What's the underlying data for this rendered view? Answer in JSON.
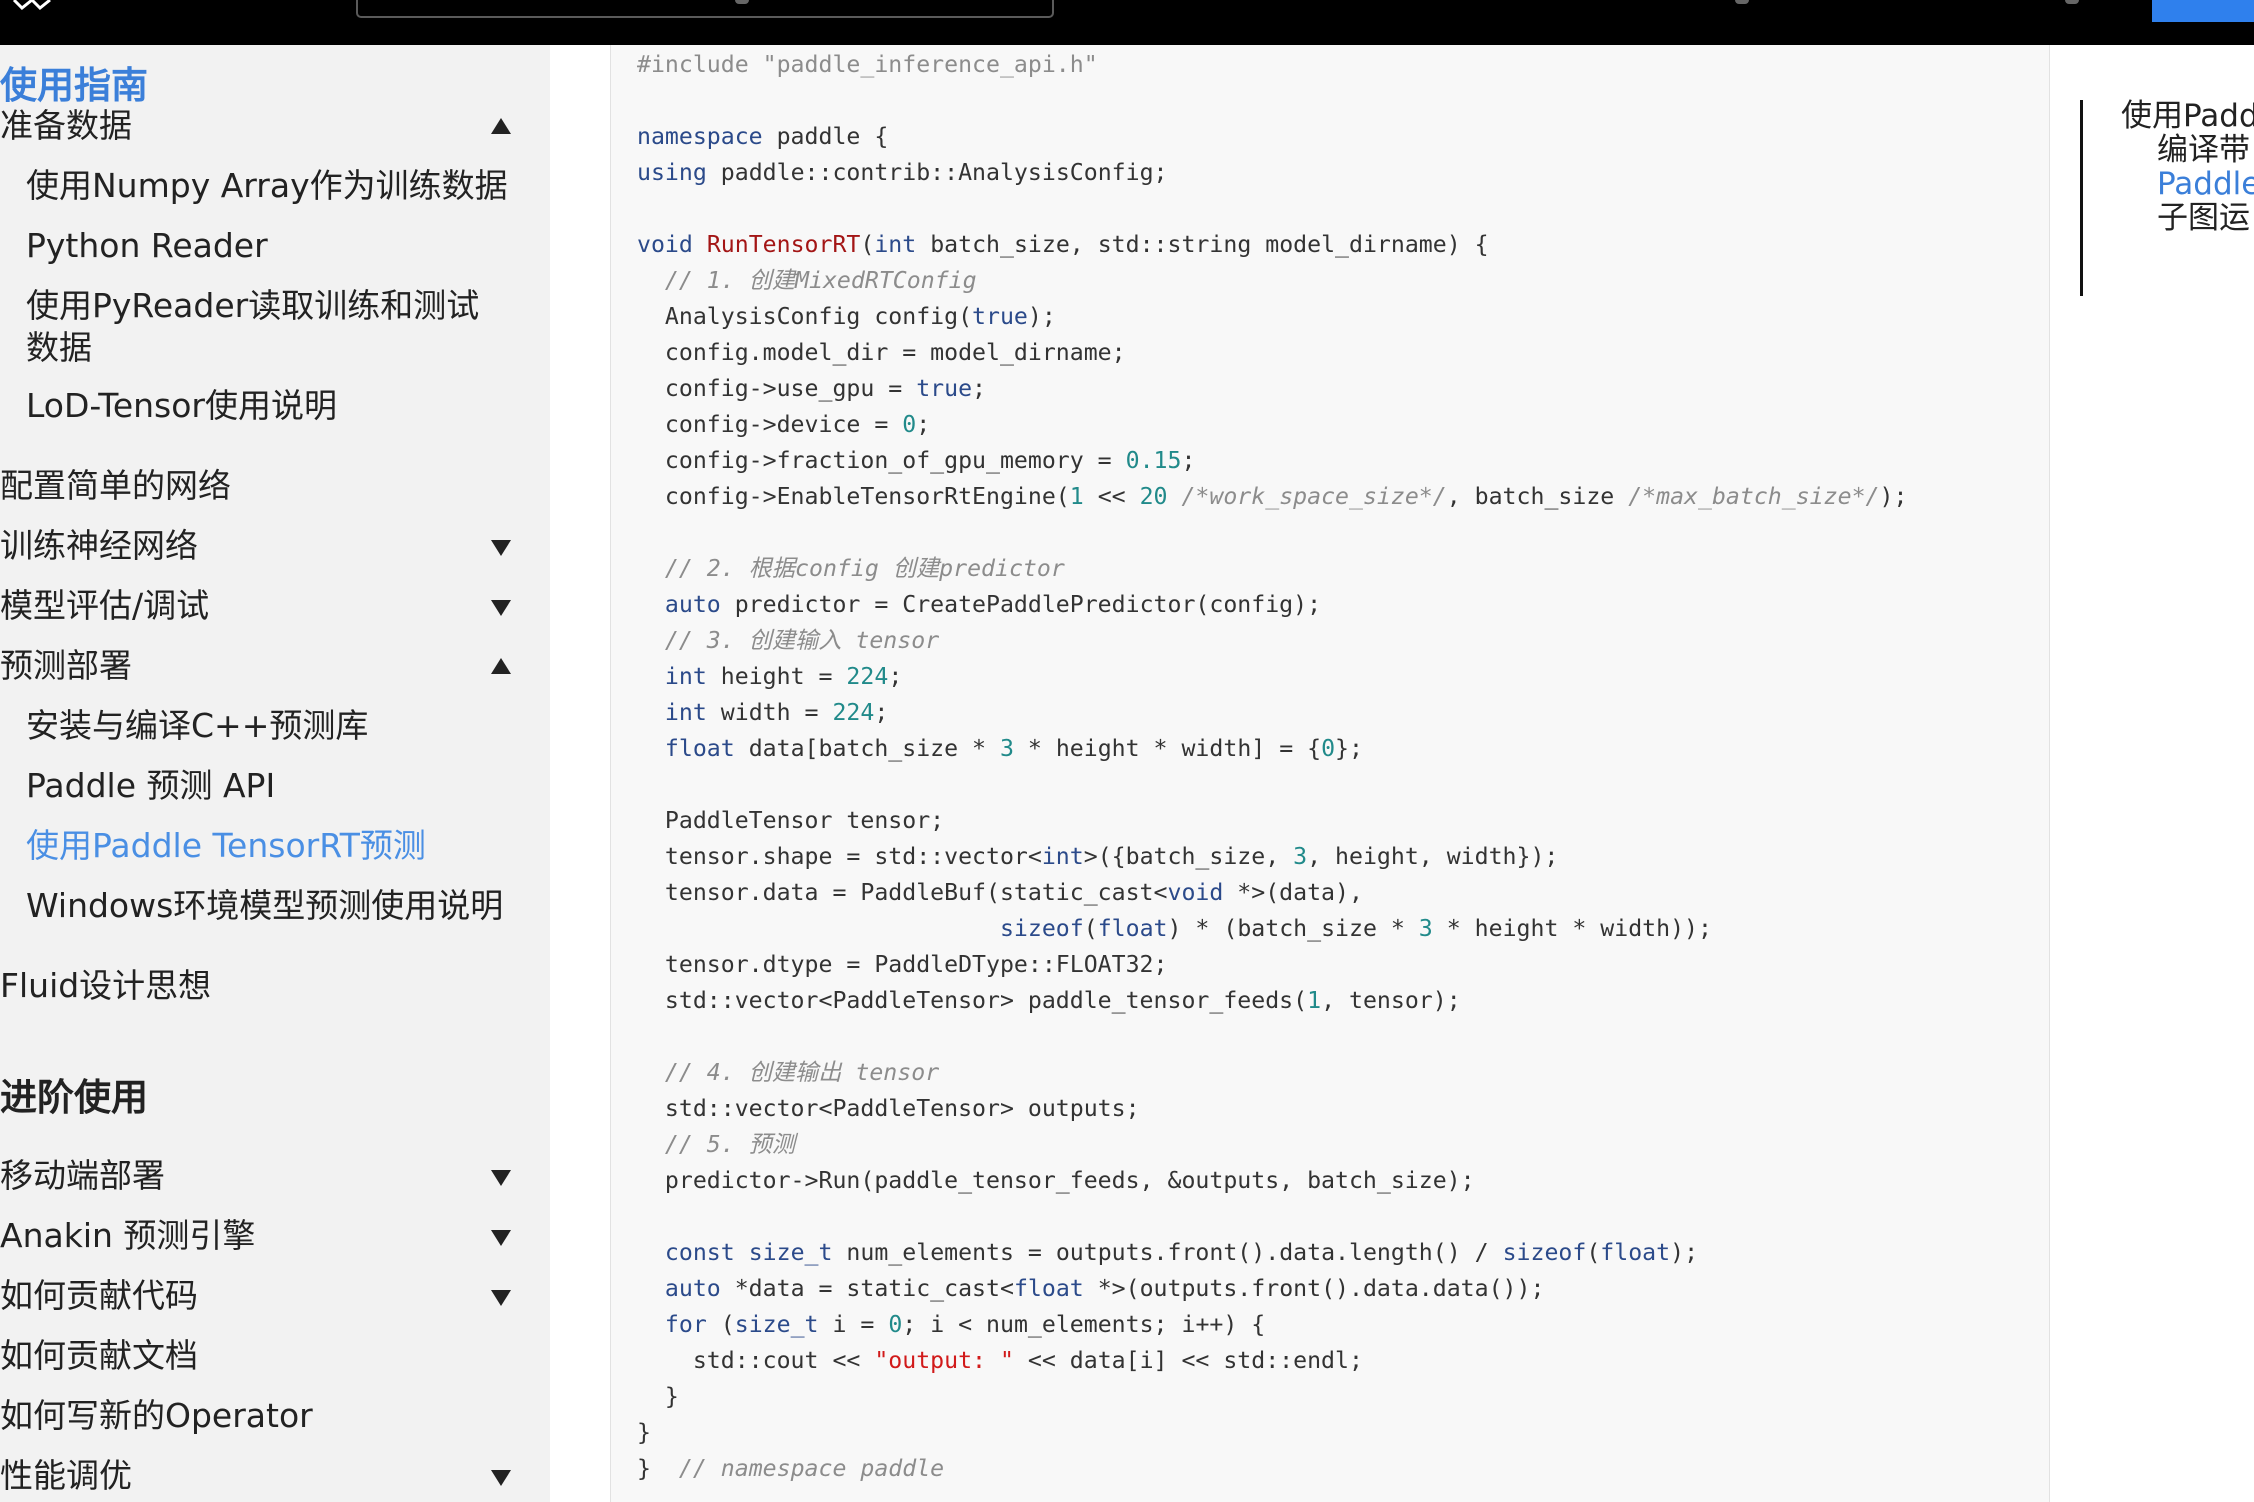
{
  "topbar": {
    "back_icon": "double-chevron-left-icon"
  },
  "sidebar": {
    "items": [
      {
        "label": "使用指南",
        "kind": "section",
        "caret": null
      },
      {
        "label": "准备数据",
        "kind": "top",
        "caret": "up"
      },
      {
        "label": "使用Numpy Array作为训练数据",
        "kind": "sub",
        "caret": null
      },
      {
        "label": "Python Reader",
        "kind": "sub",
        "caret": null
      },
      {
        "label": "使用PyReader读取训练和测试数据",
        "kind": "sub-wrap",
        "caret": null
      },
      {
        "label": "LoD-Tensor使用说明",
        "kind": "sub",
        "caret": null
      },
      {
        "label": "配置简单的网络",
        "kind": "top",
        "caret": null
      },
      {
        "label": "训练神经网络",
        "kind": "top",
        "caret": "down"
      },
      {
        "label": "模型评估/调试",
        "kind": "top",
        "caret": "down"
      },
      {
        "label": "预测部署",
        "kind": "top",
        "caret": "up"
      },
      {
        "label": "安装与编译C++预测库",
        "kind": "sub",
        "caret": null
      },
      {
        "label": "Paddle 预测 API",
        "kind": "sub",
        "caret": null
      },
      {
        "label": "使用Paddle TensorRT预测",
        "kind": "sub-active",
        "caret": null
      },
      {
        "label": "Windows环境模型预测使用说明",
        "kind": "sub",
        "caret": null
      },
      {
        "label": "Fluid设计思想",
        "kind": "top",
        "caret": null
      },
      {
        "label": "进阶使用",
        "kind": "section-dark",
        "caret": null
      },
      {
        "label": "移动端部署",
        "kind": "top",
        "caret": "down"
      },
      {
        "label": "Anakin 预测引擎",
        "kind": "top",
        "caret": "down"
      },
      {
        "label": "如何贡献代码",
        "kind": "top",
        "caret": "down"
      },
      {
        "label": "如何贡献文档",
        "kind": "top",
        "caret": null
      },
      {
        "label": "如何写新的Operator",
        "kind": "top",
        "caret": null
      },
      {
        "label": "性能调优",
        "kind": "top",
        "caret": "down"
      }
    ]
  },
  "code": {
    "lines": [
      "#include \"paddle_inference_api.h\"",
      "",
      "namespace paddle {",
      "using paddle::contrib::AnalysisConfig;",
      "",
      "void RunTensorRT(int batch_size, std::string model_dirname) {",
      "  // 1. 创建MixedRTConfig",
      "  AnalysisConfig config(true);",
      "  config.model_dir = model_dirname;",
      "  config->use_gpu = true;",
      "  config->device = 0;",
      "  config->fraction_of_gpu_memory = 0.15;",
      "  config->EnableTensorRtEngine(1 << 20 /*work_space_size*/, batch_size /*max_batch_size*/);",
      "",
      "  // 2. 根据config 创建predictor",
      "  auto predictor = CreatePaddlePredictor(config);",
      "  // 3. 创建输入 tensor",
      "  int height = 224;",
      "  int width = 224;",
      "  float data[batch_size * 3 * height * width] = {0};",
      "",
      "  PaddleTensor tensor;",
      "  tensor.shape = std::vector<int>({batch_size, 3, height, width});",
      "  tensor.data = PaddleBuf(static_cast<void *>(data),",
      "                          sizeof(float) * (batch_size * 3 * height * width));",
      "  tensor.dtype = PaddleDType::FLOAT32;",
      "  std::vector<PaddleTensor> paddle_tensor_feeds(1, tensor);",
      "",
      "  // 4. 创建输出 tensor",
      "  std::vector<PaddleTensor> outputs;",
      "  // 5. 预测",
      "  predictor->Run(paddle_tensor_feeds, &outputs, batch_size);",
      "",
      "  const size_t num_elements = outputs.front().data.length() / sizeof(float);",
      "  auto *data = static_cast<float *>(outputs.front().data.data());",
      "  for (size_t i = 0; i < num_elements; i++) {",
      "    std::cout << \"output: \" << data[i] << std::endl;",
      "  }",
      "}",
      "}  // namespace paddle"
    ]
  },
  "toc": {
    "items": [
      {
        "label": "使用Padd",
        "level": 1,
        "active": false
      },
      {
        "label": "编译带",
        "level": 2,
        "active": false
      },
      {
        "label": "Paddle",
        "level": 2,
        "active": true
      },
      {
        "label": "子图运",
        "level": 2,
        "active": false
      }
    ]
  },
  "colors": {
    "accent": "#3b7fd9",
    "topbar": "#000000",
    "sidebar_bg": "#f2f2f2",
    "code_bg": "#f8f8f8"
  }
}
